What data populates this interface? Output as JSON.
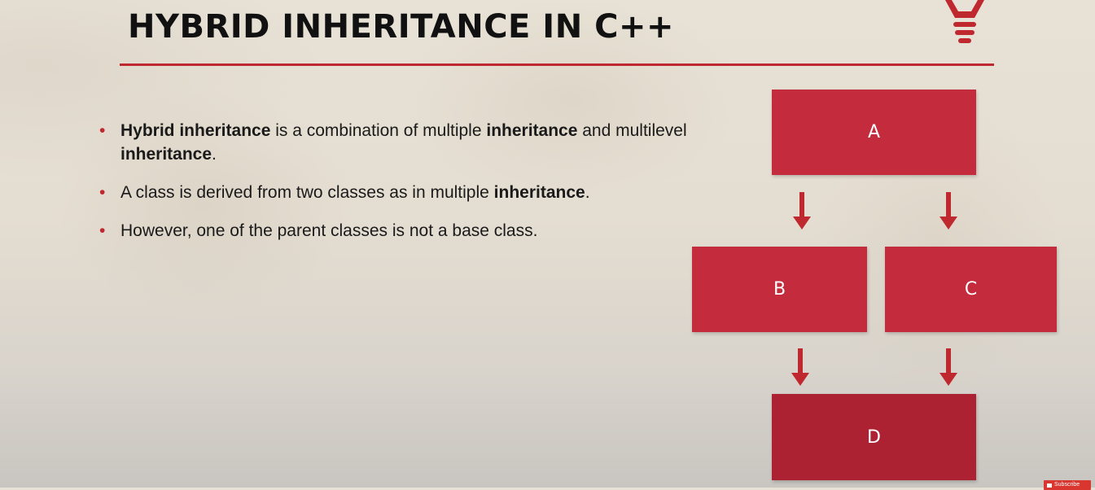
{
  "slide": {
    "title": "HYBRID INHERITANCE IN C++",
    "accent_color": "#c0282f",
    "bullet_marker": "•",
    "bullets": [
      {
        "parts": [
          {
            "text": "Hybrid inheritance",
            "bold": true
          },
          {
            "text": " is a combination of multiple ",
            "bold": false
          },
          {
            "text": "inheritance",
            "bold": true
          },
          {
            "text": " and multilevel ",
            "bold": false
          },
          {
            "text": "inheritance",
            "bold": true
          },
          {
            "text": ".",
            "bold": false
          }
        ]
      },
      {
        "parts": [
          {
            "text": "A class is derived from two classes as in multiple ",
            "bold": false
          },
          {
            "text": "inheritance",
            "bold": true
          },
          {
            "text": ".",
            "bold": false
          }
        ]
      },
      {
        "parts": [
          {
            "text": "However, one of the parent classes is not a base class.",
            "bold": false
          }
        ]
      }
    ]
  },
  "diagram": {
    "node_color": "#c42b3c",
    "node_d_color": "#ad2232",
    "arrow_color": "#c0282f",
    "nodes": {
      "a": "A",
      "b": "B",
      "c": "C",
      "d": "D"
    }
  },
  "icons": {
    "bulb": "lightbulb-icon",
    "arrow": "arrow-down-icon",
    "subscribe": "youtube-icon"
  },
  "overlay": {
    "subscribe_label": "Subscribe"
  }
}
